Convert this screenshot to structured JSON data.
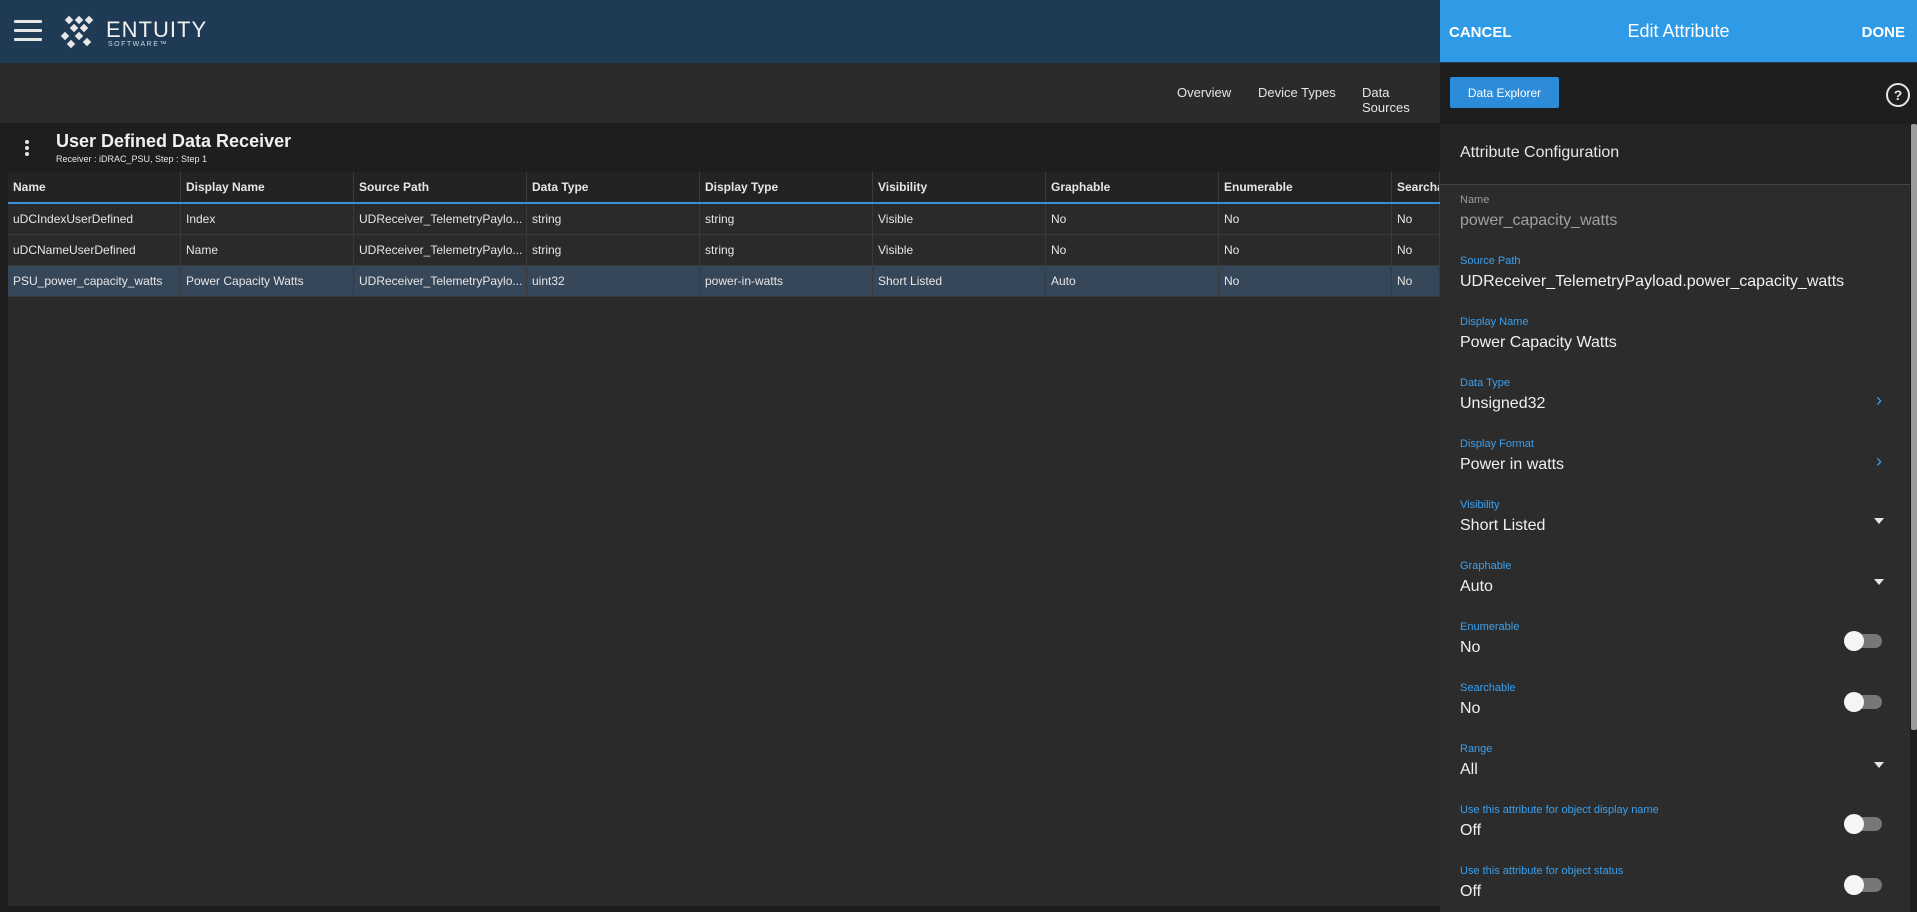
{
  "header": {
    "brand": "ENTUITY",
    "brand_sub": "SOFTWARE™"
  },
  "nav": {
    "items": [
      "Overview",
      "Device Types",
      "Data Sources"
    ],
    "button": "Data Explorer"
  },
  "page": {
    "title": "User Defined Data Receiver",
    "subtitle": "Receiver : iDRAC_PSU, Step : Step 1"
  },
  "table": {
    "columns": [
      "Name",
      "Display Name",
      "Source Path",
      "Data Type",
      "Display Type",
      "Visibility",
      "Graphable",
      "Enumerable",
      "Searcha"
    ],
    "rows": [
      [
        "uDCIndexUserDefined",
        "Index",
        "UDReceiver_TelemetryPaylo...",
        "string",
        "string",
        "Visible",
        "No",
        "No",
        "No"
      ],
      [
        "uDCNameUserDefined",
        "Name",
        "UDReceiver_TelemetryPaylo...",
        "string",
        "string",
        "Visible",
        "No",
        "No",
        "No"
      ],
      [
        "PSU_power_capacity_watts",
        "Power Capacity Watts",
        "UDReceiver_TelemetryPaylo...",
        "uint32",
        "power-in-watts",
        "Short Listed",
        "Auto",
        "No",
        "No"
      ]
    ],
    "selected_row": 2
  },
  "panel": {
    "cancel": "CANCEL",
    "title": "Edit Attribute",
    "done": "DONE",
    "section": "Attribute Configuration",
    "fields": [
      {
        "label": "Name",
        "value": "power_capacity_watts",
        "control": "readonly"
      },
      {
        "label": "Source Path",
        "value": "UDReceiver_TelemetryPayload.power_capacity_watts",
        "control": "text"
      },
      {
        "label": "Display Name",
        "value": "Power Capacity Watts",
        "control": "text"
      },
      {
        "label": "Data Type",
        "value": "Unsigned32",
        "control": "chevron"
      },
      {
        "label": "Display Format",
        "value": "Power in watts",
        "control": "chevron"
      },
      {
        "label": "Visibility",
        "value": "Short Listed",
        "control": "dropdown"
      },
      {
        "label": "Graphable",
        "value": "Auto",
        "control": "dropdown"
      },
      {
        "label": "Enumerable",
        "value": "No",
        "control": "toggle"
      },
      {
        "label": "Searchable",
        "value": "No",
        "control": "toggle"
      },
      {
        "label": "Range",
        "value": "All",
        "control": "dropdown"
      },
      {
        "label": "Use this attribute for object display name",
        "value": "Off",
        "control": "toggle"
      },
      {
        "label": "Use this attribute for object status",
        "value": "Off",
        "control": "toggle"
      }
    ]
  },
  "colors": {
    "header_bg": "#1e3a54",
    "panel_header": "#2f9be6",
    "accent": "#3aa0ef",
    "button": "#2d8cd9",
    "selected_row": "#37475a"
  },
  "icons": {
    "menu": "hamburger-icon",
    "logo": "entuity-logo-icon",
    "more": "kebab-icon",
    "help": "help-icon",
    "chevron": "chevron-right-icon",
    "dropdown": "caret-down-icon"
  }
}
